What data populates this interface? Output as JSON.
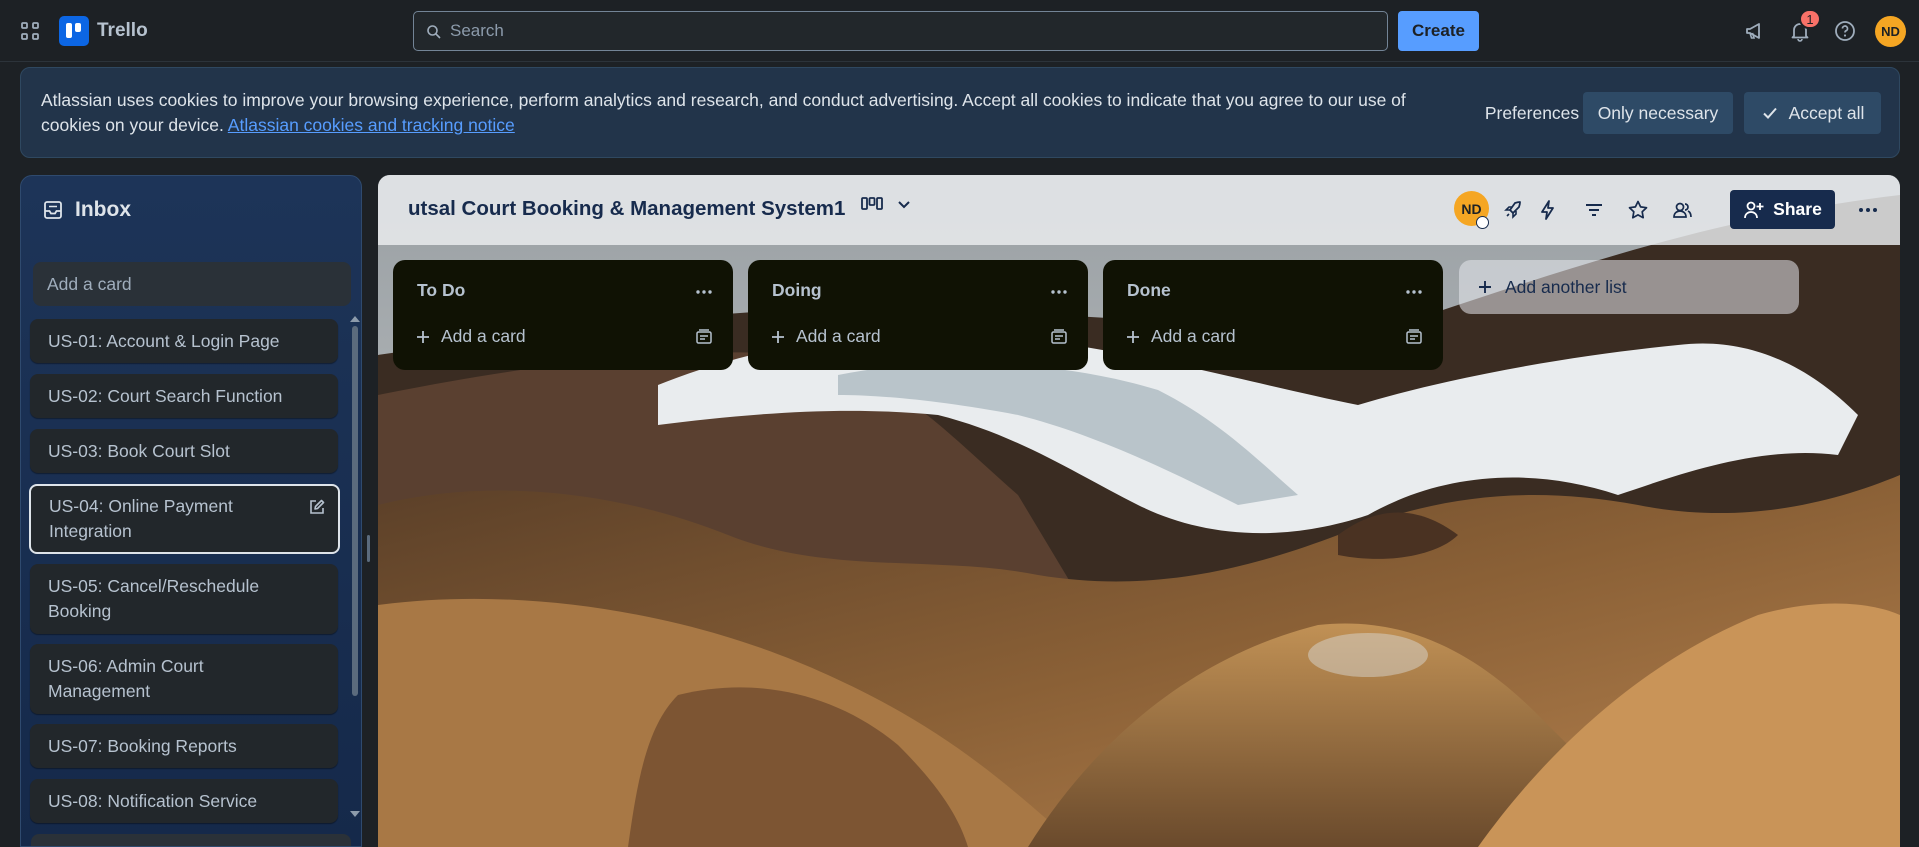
{
  "topbar": {
    "apps_icon": "grid-icon",
    "brand": "Trello",
    "search_placeholder": "Search",
    "create_label": "Create",
    "notification_count": "1",
    "avatar_initials": "ND"
  },
  "cookie_banner": {
    "text": "Atlassian uses cookies to improve your browsing experience, perform analytics and research, and conduct advertising. Accept all cookies to indicate that you agree to our use of cookies on your device.",
    "link_text": "Atlassian cookies and tracking notice",
    "preferences_label": "Preferences",
    "only_necessary_label": "Only necessary",
    "accept_all_label": "Accept all"
  },
  "inbox": {
    "title": "Inbox",
    "add_card_placeholder": "Add a card",
    "cards": [
      {
        "label": "US-01: Account & Login Page"
      },
      {
        "label": "US-02: Court Search Function"
      },
      {
        "label": "US-03: Book Court Slot"
      },
      {
        "label": "US-04: Online Payment Integration"
      },
      {
        "label": "US-05: Cancel/Reschedule Booking"
      },
      {
        "label": "US-06: Admin Court Management"
      },
      {
        "label": "US-07: Booking Reports"
      },
      {
        "label": "US-08: Notification Service"
      }
    ]
  },
  "board": {
    "title": "utsal Court Booking & Management System1",
    "avatar_initials": "ND",
    "share_label": "Share",
    "lists": [
      {
        "title": "To Do",
        "add_label": "Add a card"
      },
      {
        "title": "Doing",
        "add_label": "Add a card"
      },
      {
        "title": "Done",
        "add_label": "Add a card"
      }
    ],
    "add_list_label": "Add another list"
  },
  "colors": {
    "accent": "#579dff",
    "brand": "#0c66e4",
    "avatar": "#f5a623",
    "list_bg": "#101204",
    "share_bg": "#172b4d"
  }
}
